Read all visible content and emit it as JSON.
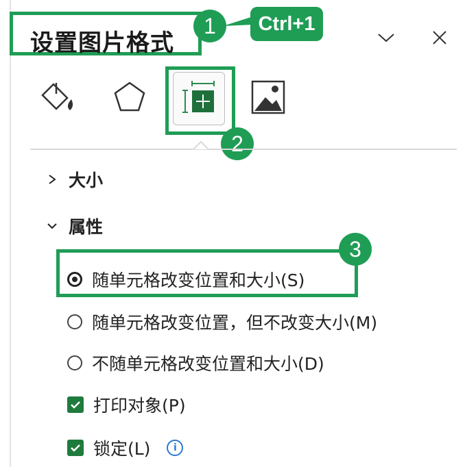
{
  "header": {
    "title": "设置图片格式",
    "collapse_icon": "chevron-down-icon",
    "close_icon": "close-icon"
  },
  "annotations": {
    "step1": "1",
    "step2": "2",
    "step3": "3",
    "shortcut": "Ctrl+1",
    "accent_color": "#1f9d55"
  },
  "tabs": [
    {
      "icon": "fill-line-icon"
    },
    {
      "icon": "effects-icon"
    },
    {
      "icon": "size-properties-icon",
      "selected": true
    },
    {
      "icon": "picture-icon"
    }
  ],
  "sections": {
    "size": {
      "label": "大小",
      "expanded": false
    },
    "properties": {
      "label": "属性",
      "expanded": true
    }
  },
  "options": {
    "move_and_size": "随单元格改变位置和大小(S)",
    "move_not_size": "随单元格改变位置，但不改变大小(M)",
    "dont_move": "不随单元格改变位置和大小(D)",
    "print": "打印对象(P)",
    "lock": "锁定(L)"
  },
  "colors": {
    "check_fill": "#1f7a3d",
    "info_color": "#2a78d2"
  }
}
